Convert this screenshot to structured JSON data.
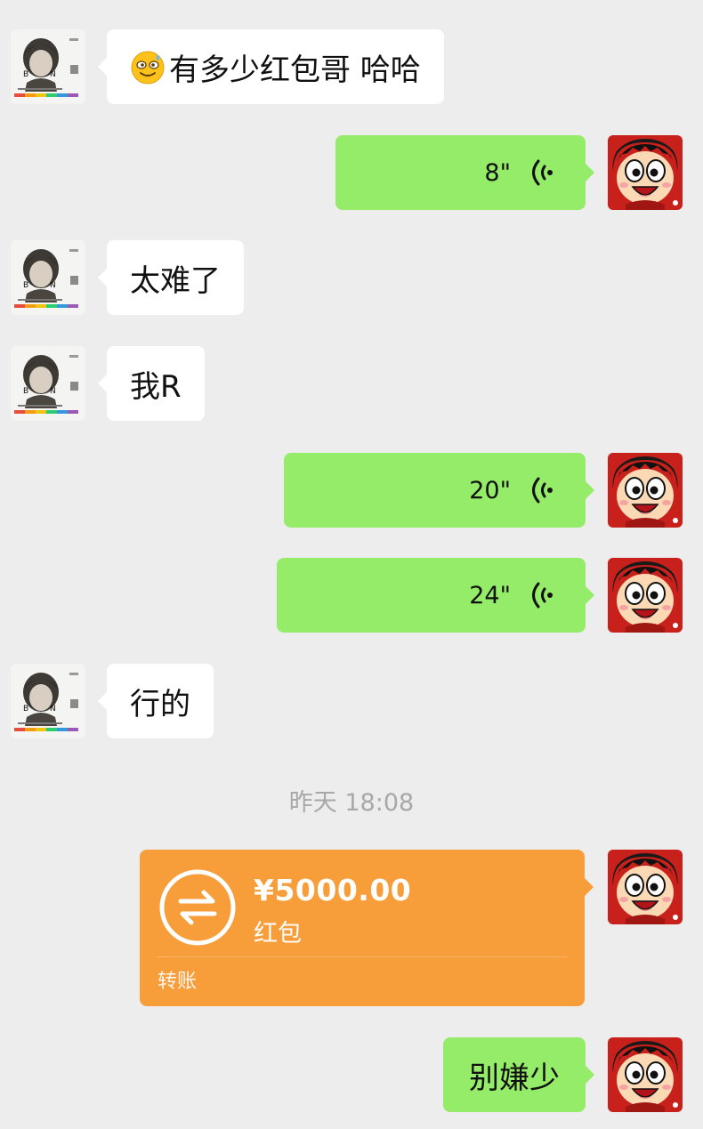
{
  "messages": [
    {
      "side": "in",
      "text": "有多少红包哥 哈哈",
      "emoji": "grinning-sweat-emoji"
    },
    {
      "side": "out",
      "type": "voice",
      "duration": "8\""
    },
    {
      "side": "in",
      "text": "太难了"
    },
    {
      "side": "in",
      "text": "我R"
    },
    {
      "side": "out",
      "type": "voice",
      "duration": "20\""
    },
    {
      "side": "out",
      "type": "voice",
      "duration": "24\""
    },
    {
      "side": "in",
      "text": "行的"
    }
  ],
  "timestamp": "昨天 18:08",
  "transfer": {
    "amount": "¥5000.00",
    "note": "红包",
    "footer": "转账",
    "color": "#f79e3a",
    "icon": "transfer-arrows-icon"
  },
  "last_message": {
    "side": "out",
    "text": "别嫌少"
  },
  "colors": {
    "background": "#ededed",
    "incoming_bubble": "#ffffff",
    "outgoing_bubble": "#95ec69",
    "timestamp_text": "#a8a8a8"
  },
  "avatars": {
    "contact": "contact-avatar-portrait",
    "self": "self-avatar-cartoon-boy"
  }
}
